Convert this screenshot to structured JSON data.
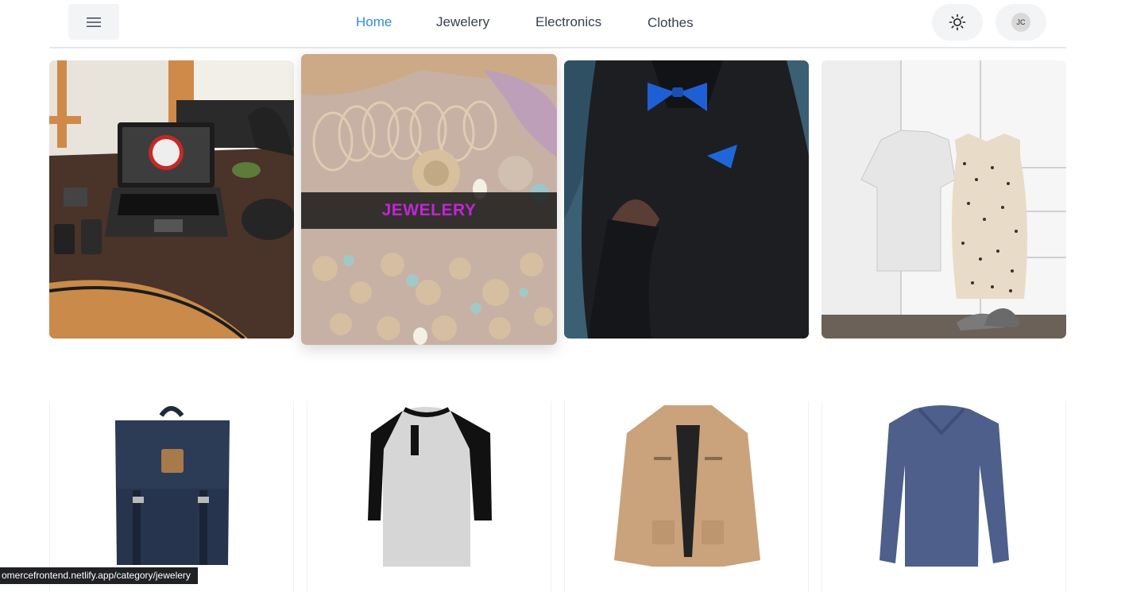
{
  "header": {
    "nav": [
      {
        "label": "Home",
        "active": true
      },
      {
        "label": "Jewelery",
        "active": false
      },
      {
        "label": "Electronics",
        "active": false
      },
      {
        "label": "Clothes",
        "active": false
      }
    ],
    "avatar_initials": "JC",
    "icons": {
      "menu": "menu-icon",
      "theme": "sun-icon"
    },
    "accent_color": "#2b8fd6"
  },
  "categories": [
    {
      "name": "electronics",
      "overlay_label": ""
    },
    {
      "name": "jewelery",
      "overlay_label": "JEWELERY"
    },
    {
      "name": "mens-clothing",
      "overlay_label": ""
    },
    {
      "name": "womens-clothing",
      "overlay_label": ""
    }
  ],
  "products": [
    {
      "kind": "backpack"
    },
    {
      "kind": "raglan-henley-shirt"
    },
    {
      "kind": "khaki-jacket"
    },
    {
      "kind": "blue-long-sleeve-tee"
    }
  ],
  "status_bar": {
    "url": "omercefrontend.netlify.app/category/jewelery"
  }
}
